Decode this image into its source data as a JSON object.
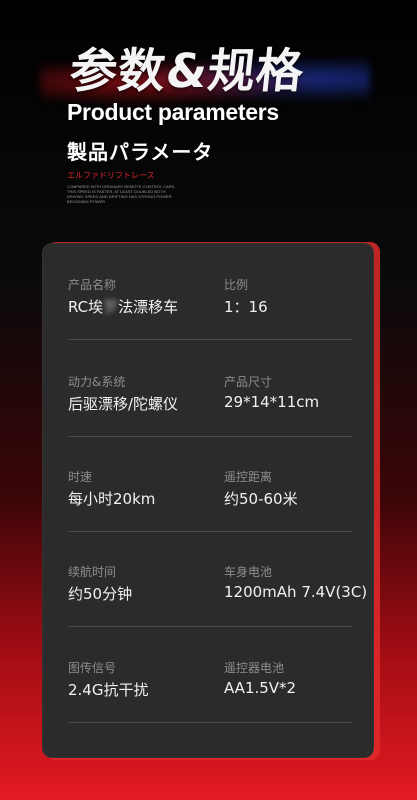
{
  "header": {
    "title_cn": "参数&规格",
    "title_en": "Product parameters",
    "title_jp": "製品パラメータ",
    "title_jp_red": "エルファドリフトレース",
    "note": "COMPARED WITH ORDINARY REMOTE CONTROL CARS, THIS SPEED IS FASTER, AT LEAST DOUBLED BOTH DRIVING SPEED AND DRIFTING HAS STRONG POWER. BECOMING POWER"
  },
  "colors": {
    "accent_red": "#e0232b",
    "card_bg": "#2b2b2b",
    "label_gray": "#8d8d8d"
  },
  "specs": [
    {
      "left": {
        "label": "产品名称",
        "value_a": "RC埃",
        "value_b": "罗",
        "value_c": "法漂移车"
      },
      "right": {
        "label": "比例",
        "value": "1：16"
      }
    },
    {
      "left": {
        "label": "动力&系统",
        "value": "后驱漂移/陀螺仪"
      },
      "right": {
        "label": "产品尺寸",
        "value": "29*14*11cm"
      }
    },
    {
      "left": {
        "label": "时速",
        "value": "每小时20km"
      },
      "right": {
        "label": "遥控距离",
        "value": "约50-60米"
      }
    },
    {
      "left": {
        "label": "续航时间",
        "value": "约50分钟"
      },
      "right": {
        "label": "车身电池",
        "value": "1200mAh 7.4V(3C)"
      }
    },
    {
      "left": {
        "label": "图传信号",
        "value": "2.4G抗干扰"
      },
      "right": {
        "label": "遥控器电池",
        "value": "AA1.5V*2"
      }
    }
  ]
}
